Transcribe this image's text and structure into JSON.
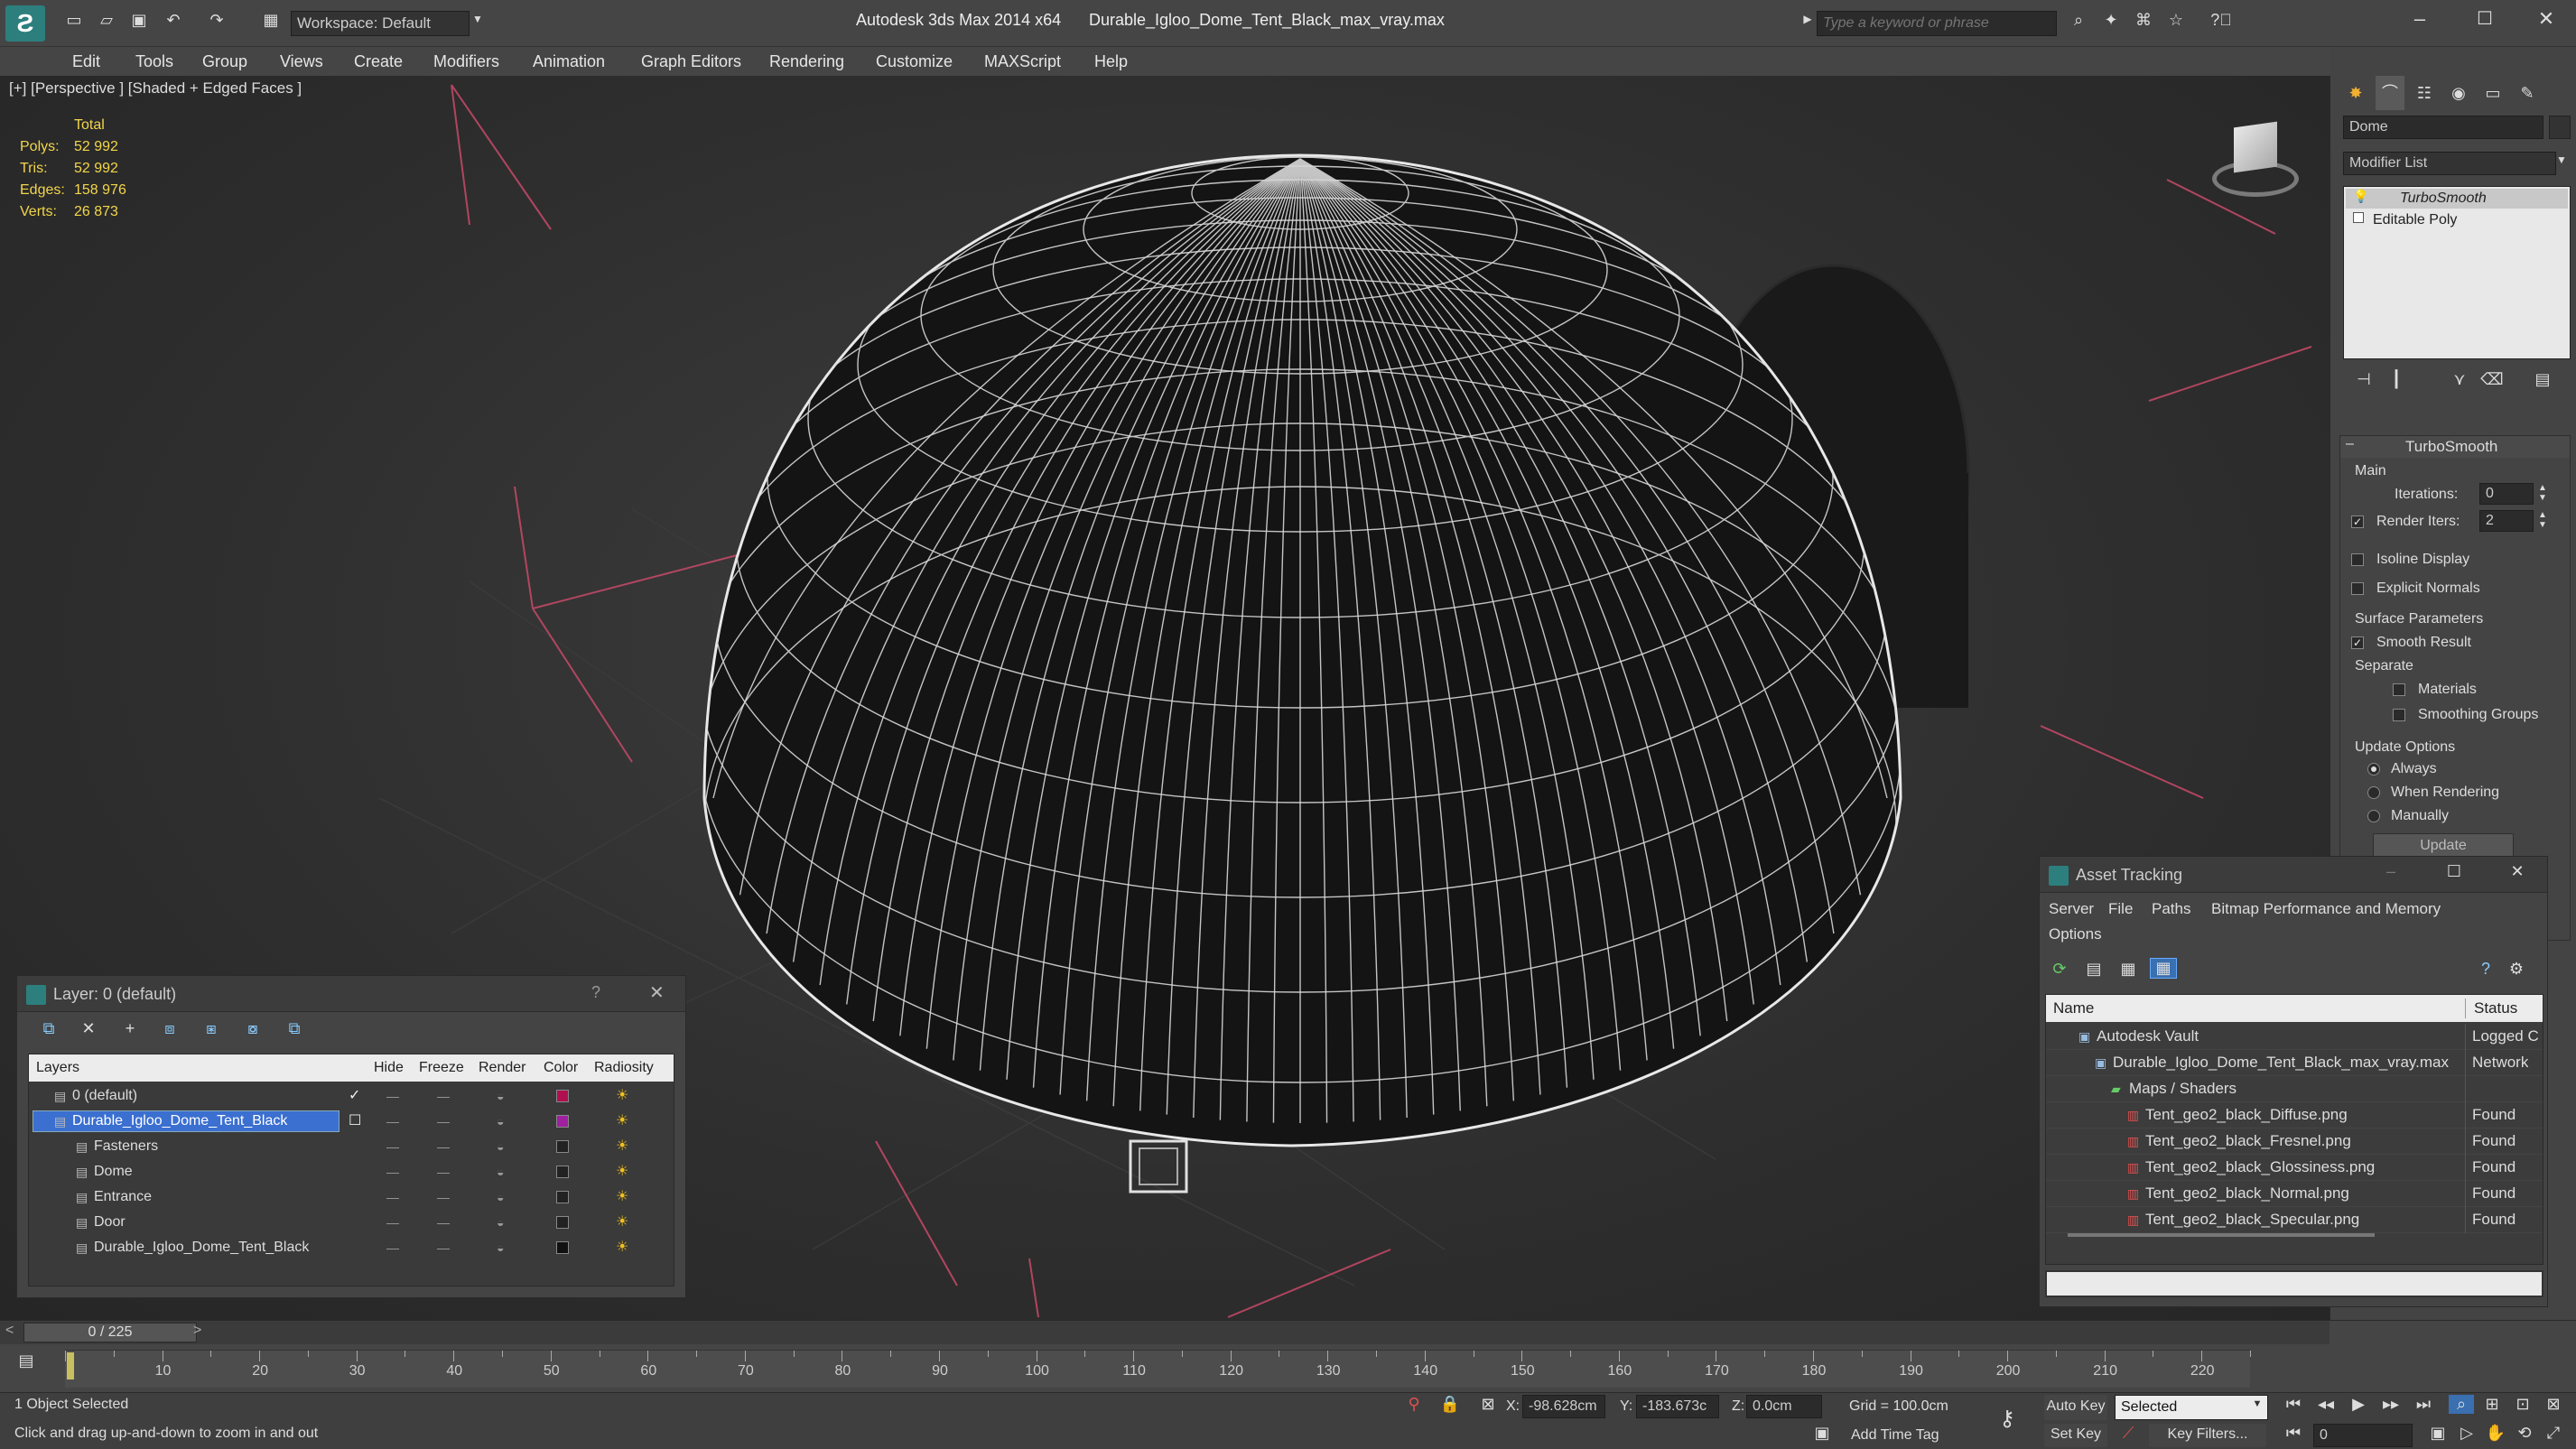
{
  "titlebar": {
    "app_title": "Autodesk 3ds Max  2014 x64",
    "file_title": "Durable_Igloo_Dome_Tent_Black_max_vray.max",
    "workspace": "Workspace: Default",
    "search_placeholder": "Type a keyword or phrase"
  },
  "menu": [
    "Edit",
    "Tools",
    "Group",
    "Views",
    "Create",
    "Modifiers",
    "Animation",
    "Graph Editors",
    "Rendering",
    "Customize",
    "MAXScript",
    "Help"
  ],
  "viewport": {
    "label": "[+] [Perspective ] [Shaded + Edged Faces ]",
    "stats_header": "Total",
    "stats": [
      {
        "label": "Polys:",
        "value": "52 992"
      },
      {
        "label": "Tris:",
        "value": "52 992"
      },
      {
        "label": "Edges:",
        "value": "158 976"
      },
      {
        "label": "Verts:",
        "value": "26 873"
      }
    ]
  },
  "command_panel": {
    "object_name": "Dome",
    "modifier_list": "Modifier List",
    "stack": [
      "TurboSmooth",
      "Editable Poly"
    ],
    "rollout_title": "TurboSmooth",
    "main_label": "Main",
    "iterations_label": "Iterations:",
    "iterations_value": "0",
    "render_iters_label": "Render Iters:",
    "render_iters_value": "2",
    "isoline_label": "Isoline Display",
    "explicit_label": "Explicit Normals",
    "surface_label": "Surface Parameters",
    "smooth_label": "Smooth Result",
    "separate_label": "Separate",
    "materials_label": "Materials",
    "smoothing_label": "Smoothing Groups",
    "update_options_label": "Update Options",
    "always_label": "Always",
    "when_rendering_label": "When Rendering",
    "manually_label": "Manually",
    "update_button": "Update"
  },
  "layer_panel": {
    "title": "Layer: 0 (default)",
    "help": "?",
    "columns": [
      "Layers",
      "Hide",
      "Freeze",
      "Render",
      "Color",
      "Radiosity"
    ],
    "rows": [
      {
        "name": "0 (default)",
        "color": "#b01050",
        "indent": 0
      },
      {
        "name": "Durable_Igloo_Dome_Tent_Black",
        "color": "#a020a0",
        "indent": 0,
        "selected": true
      },
      {
        "name": "Fasteners",
        "color": "#222222",
        "indent": 1
      },
      {
        "name": "Dome",
        "color": "#222222",
        "indent": 1
      },
      {
        "name": "Entrance",
        "color": "#222222",
        "indent": 1
      },
      {
        "name": "Door",
        "color": "#222222",
        "indent": 1
      },
      {
        "name": "Durable_Igloo_Dome_Tent_Black",
        "color": "#111111",
        "indent": 1
      }
    ]
  },
  "asset_panel": {
    "title": "Asset Tracking",
    "menu": [
      "Server",
      "File",
      "Paths",
      "Bitmap Performance and Memory"
    ],
    "menu2": "Options",
    "col_name": "Name",
    "col_status": "Status",
    "rows": [
      {
        "name": "Autodesk Vault",
        "status": "Logged C",
        "indent": 1
      },
      {
        "name": "Durable_Igloo_Dome_Tent_Black_max_vray.max",
        "status": "Network",
        "indent": 2
      },
      {
        "name": "Maps / Shaders",
        "status": "",
        "indent": 3
      },
      {
        "name": "Tent_geo2_black_Diffuse.png",
        "status": "Found",
        "indent": 4
      },
      {
        "name": "Tent_geo2_black_Fresnel.png",
        "status": "Found",
        "indent": 4
      },
      {
        "name": "Tent_geo2_black_Glossiness.png",
        "status": "Found",
        "indent": 4
      },
      {
        "name": "Tent_geo2_black_Normal.png",
        "status": "Found",
        "indent": 4
      },
      {
        "name": "Tent_geo2_black_Specular.png",
        "status": "Found",
        "indent": 4
      }
    ]
  },
  "timeline": {
    "frame_counter": "0 / 225",
    "ticks": [
      "10",
      "20",
      "30",
      "40",
      "50",
      "60",
      "70",
      "80",
      "90",
      "100",
      "110",
      "120",
      "130",
      "140",
      "150",
      "160",
      "170",
      "180",
      "190",
      "200",
      "210",
      "220"
    ]
  },
  "status": {
    "selected": "1 Object Selected",
    "prompt": "Click and drag up-and-down to zoom in and out",
    "x_label": "X:",
    "x_value": "-98.628cm",
    "y_label": "Y:",
    "y_value": "-183.673c",
    "z_label": "Z:",
    "z_value": "0.0cm",
    "grid": "Grid = 100.0cm",
    "add_time_tag": "Add Time Tag",
    "auto_key": "Auto Key",
    "set_key": "Set Key",
    "selected_dropdown": "Selected",
    "key_filters": "Key Filters...",
    "frame_value": "0"
  }
}
